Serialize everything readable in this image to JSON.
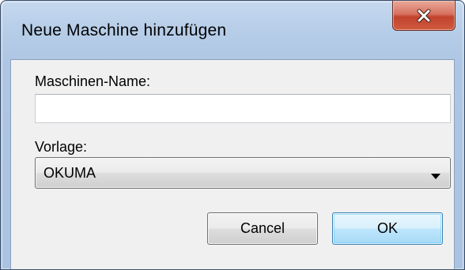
{
  "window": {
    "title": "Neue Maschine hinzufügen",
    "close_icon": "close-x-icon"
  },
  "form": {
    "name_label": "Maschinen-Name:",
    "name_value": "",
    "name_placeholder": "",
    "template_label": "Vorlage:",
    "template_selected": "OKUMA",
    "template_arrow_icon": "dropdown-arrow-icon"
  },
  "buttons": {
    "cancel_label": "Cancel",
    "ok_label": "OK"
  },
  "colors": {
    "titlebar": "#b6cde8",
    "close_button": "#c7462f",
    "client_background": "#f0f0f0",
    "default_button_border": "#3c7fb1"
  }
}
